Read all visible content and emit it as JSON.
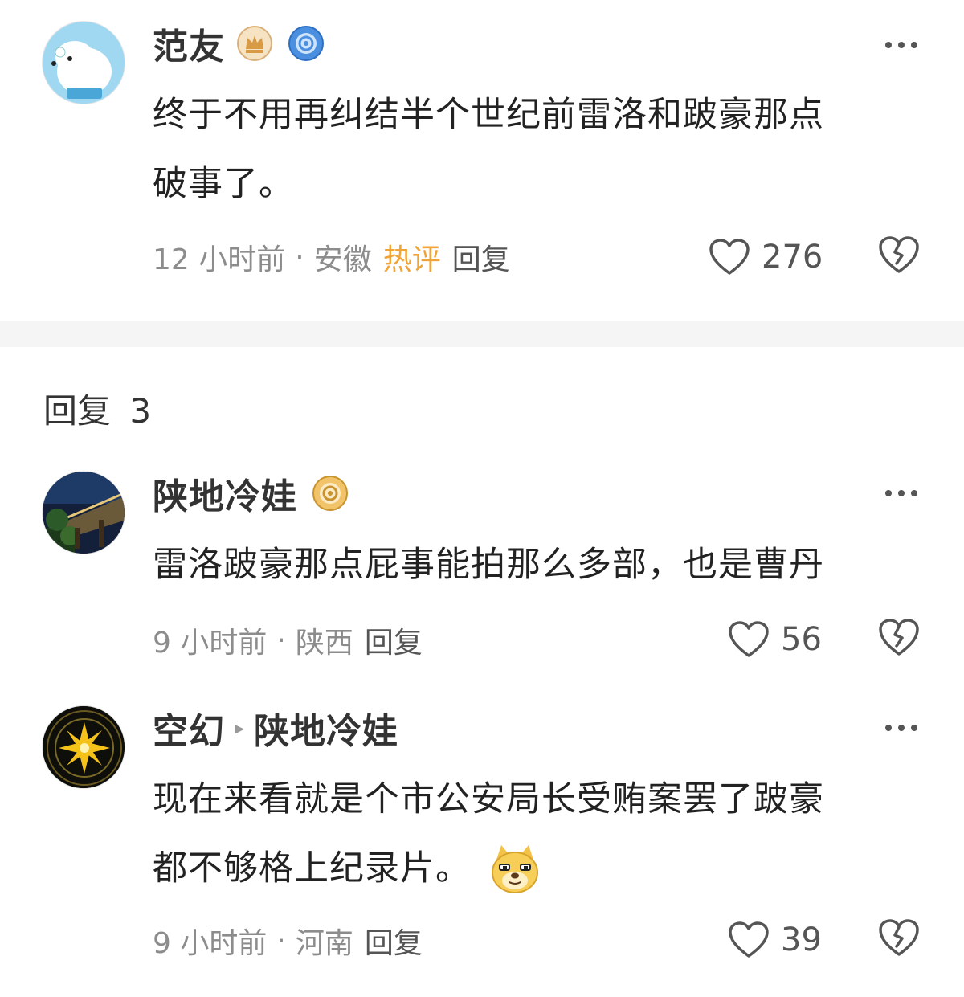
{
  "main_comment": {
    "username": "范友",
    "text_line1": "终于不用再纠结半个世纪前雷洛和跛豪那点",
    "text_line2": "破事了。",
    "time": "12 小时前",
    "location": "安徽",
    "hot_label": "热评",
    "reply_label": "回复",
    "likes": "276"
  },
  "replies_header": {
    "label": "回复",
    "count": "3"
  },
  "replies": [
    {
      "username": "陕地冷娃",
      "text_line1": "雷洛跛豪那点屁事能拍那么多部，也是曹丹",
      "time": "9 小时前",
      "location": "陕西",
      "reply_label": "回复",
      "likes": "56"
    },
    {
      "username": "空幻",
      "reply_to": "陕地冷娃",
      "text_line1": "现在来看就是个市公安局长受贿案罢了跛豪",
      "text_line2": "都不够格上纪录片。",
      "time": "9 小时前",
      "location": "河南",
      "reply_label": "回复",
      "likes": "39"
    }
  ],
  "separator": "·",
  "icons": {
    "more": "more-dots-icon",
    "like": "heart-outline-icon",
    "dislike": "broken-heart-icon",
    "crown_badge": "crown-badge-icon",
    "vip_badge": "vip-disc-badge-icon",
    "emoji": "doge-emoji-icon"
  },
  "colors": {
    "hot": "#f0a336",
    "meta": "#8c8c8c",
    "divider": "#f5f5f5"
  }
}
